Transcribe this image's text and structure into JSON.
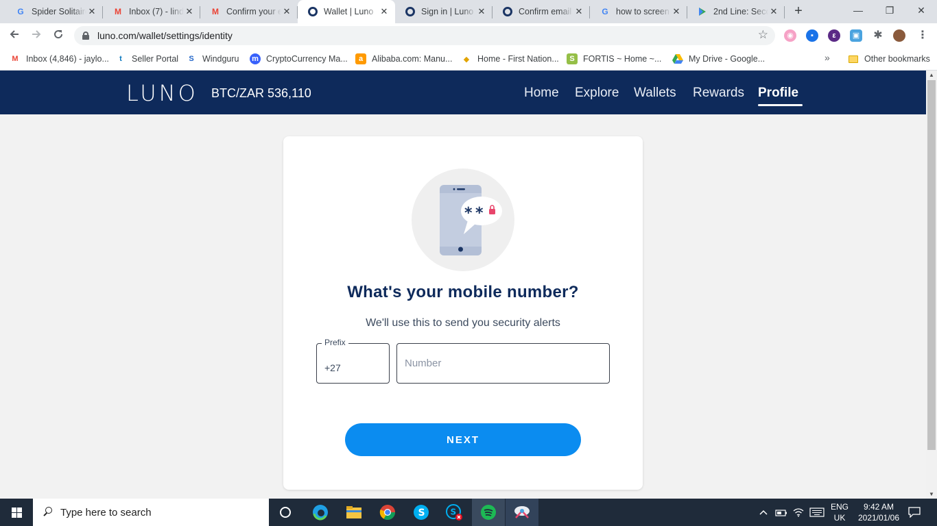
{
  "browser": {
    "tabs": [
      {
        "title": "Spider Solitaire",
        "favicon": "google-icon",
        "active": false
      },
      {
        "title": "Inbox (7) - lind",
        "favicon": "gmail-icon",
        "active": false
      },
      {
        "title": "Confirm your e",
        "favicon": "gmail-icon",
        "active": false
      },
      {
        "title": "Wallet | Luno",
        "favicon": "luno-icon",
        "active": true
      },
      {
        "title": "Sign in | Luno",
        "favicon": "luno-icon",
        "active": false
      },
      {
        "title": "Confirm email",
        "favicon": "luno-icon",
        "active": false
      },
      {
        "title": "how to screen",
        "favicon": "google-icon",
        "active": false
      },
      {
        "title": "2nd Line: Seco",
        "favicon": "play-icon",
        "active": false
      }
    ],
    "url": "luno.com/wallet/settings/identity",
    "bookmarks": [
      {
        "label": "Inbox (4,846) - jaylo...",
        "icon": "gmail-icon"
      },
      {
        "label": "Seller Portal",
        "icon": "takealot-icon"
      },
      {
        "label": "Windguru",
        "icon": "windguru-icon"
      },
      {
        "label": "CryptoCurrency Ma...",
        "icon": "coinmarketcap-icon"
      },
      {
        "label": "Alibaba.com: Manu...",
        "icon": "alibaba-icon"
      },
      {
        "label": "Home - First Nation...",
        "icon": "fnb-icon"
      },
      {
        "label": "FORTIS ~ Home ~...",
        "icon": "shopify-icon"
      },
      {
        "label": "My Drive - Google...",
        "icon": "google-drive-icon"
      }
    ],
    "other_bookmarks": "Other bookmarks"
  },
  "luno": {
    "logo": "LUNO",
    "ticker": "BTC/ZAR 536,110",
    "nav": [
      {
        "label": "Home",
        "active": false
      },
      {
        "label": "Explore",
        "active": false
      },
      {
        "label": "Wallets",
        "active": false
      },
      {
        "label": "Rewards",
        "active": false
      },
      {
        "label": "Profile",
        "active": true
      }
    ],
    "card": {
      "heading": "What's your mobile number?",
      "subheading": "We'll use this to send you security alerts",
      "prefix_label": "Prefix",
      "prefix_value": "+27",
      "number_placeholder": "Number",
      "number_value": "",
      "next_label": "NEXT"
    }
  },
  "taskbar": {
    "search_placeholder": "Type here to search",
    "language": "ENG",
    "region": "UK",
    "time": "9:42 AM",
    "date": "2021/01/06"
  },
  "colors": {
    "luno_navy": "#0e2a5b",
    "luno_blue": "#0b8cf0"
  }
}
